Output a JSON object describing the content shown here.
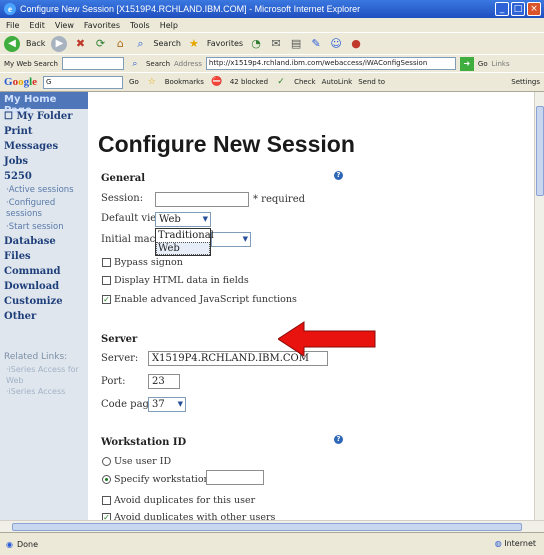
{
  "window": {
    "title": "Configure New Session [X1519P4.RCHLAND.IBM.COM] - Microsoft Internet Explorer"
  },
  "menubar": {
    "items": [
      "File",
      "Edit",
      "View",
      "Favorites",
      "Tools",
      "Help"
    ]
  },
  "toolbar": {
    "back": "Back",
    "search": "Search",
    "favorites": "Favorites"
  },
  "addressbar": {
    "search_label": "My Web Search",
    "search_btn": "Search",
    "address_label": "Address",
    "url": "http://x1519p4.rchland.ibm.com/webaccess/iWAConfigSession",
    "go": "Go",
    "links": "Links"
  },
  "googlebar": {
    "go": "Go",
    "bookmarks": "Bookmarks",
    "blocked": "42 blocked",
    "check": "Check",
    "autolink": "AutoLink",
    "sendto": "Send to",
    "settings": "Settings"
  },
  "sidebar": {
    "home": "My Home Page",
    "items": [
      {
        "label": "My Folder",
        "kind": "item"
      },
      {
        "label": "Print",
        "kind": "item"
      },
      {
        "label": "Messages",
        "kind": "item"
      },
      {
        "label": "Jobs",
        "kind": "item"
      },
      {
        "label": "5250",
        "kind": "item"
      },
      {
        "label": "Active sessions",
        "kind": "sub"
      },
      {
        "label": "Configured sessions",
        "kind": "sub"
      },
      {
        "label": "Start session",
        "kind": "sub"
      },
      {
        "label": "Database",
        "kind": "item"
      },
      {
        "label": "Files",
        "kind": "item"
      },
      {
        "label": "Command",
        "kind": "item"
      },
      {
        "label": "Download",
        "kind": "item"
      },
      {
        "label": "Customize",
        "kind": "item"
      },
      {
        "label": "Other",
        "kind": "item"
      }
    ],
    "related_heading": "Related Links:",
    "related": [
      "iSeries Access for Web",
      "iSeries Access"
    ]
  },
  "page": {
    "title": "Configure New Session"
  },
  "general": {
    "heading": "General",
    "session_label": "Session:",
    "session_value": "",
    "required": "* required",
    "default_view_label": "Default view:",
    "default_view_value": "Web",
    "default_view_options": [
      "Traditional",
      "Web"
    ],
    "initial_macro_label": "Initial macro:",
    "initial_macro_value": "",
    "bypass_signon": "Bypass signon",
    "display_html": "Display HTML data in fields",
    "enable_js": "Enable advanced JavaScript functions"
  },
  "server": {
    "heading": "Server",
    "server_label": "Server:",
    "server_value": "X1519P4.RCHLAND.IBM.COM",
    "port_label": "Port:",
    "port_value": "23",
    "codepage_label": "Code page:",
    "codepage_value": "37"
  },
  "workstation": {
    "heading": "Workstation ID",
    "use_user_id": "Use user ID",
    "specify_id": "Specify workstation ID",
    "specify_value": "",
    "avoid_user": "Avoid duplicates for this user",
    "avoid_other": "Avoid duplicates with other users"
  },
  "status": {
    "text": "Done",
    "zone": "Internet"
  },
  "colors": {
    "arrow": "#e8130f",
    "sidebar_home": "#4f76b8",
    "sidebar_link": "#1f3f7a"
  }
}
